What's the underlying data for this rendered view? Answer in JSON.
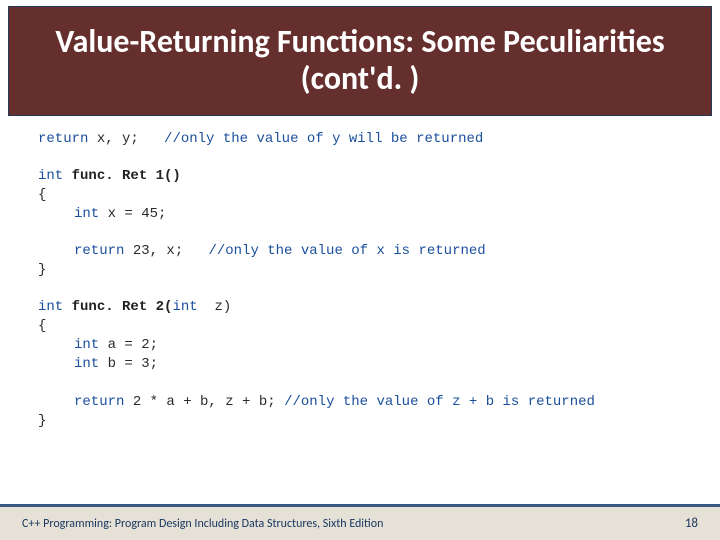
{
  "slide": {
    "title": "Value-Returning Functions: Some Peculiarities (cont'd. )"
  },
  "code": {
    "line1_return": "return",
    "line1_expr": " x, y;   ",
    "line1_comment": "//only the value of y will be returned",
    "func1_sig_kw": "int",
    "func1_sig_name": " func. Ret 1()",
    "brace_open": "{",
    "func1_decl_kw": "int",
    "func1_decl_rest": " x = 45;",
    "func1_ret_kw": "return",
    "func1_ret_expr": " 23, x;   ",
    "func1_ret_comment": "//only the value of x is returned",
    "brace_close": "}",
    "func2_sig_kw1": "int",
    "func2_sig_name": " func. Ret 2(",
    "func2_sig_kw2": "int",
    "func2_sig_rest": "  z)",
    "func2_decl1_kw": "int",
    "func2_decl1_rest": " a = 2;",
    "func2_decl2_kw": "int",
    "func2_decl2_rest": " b = 3;",
    "func2_ret_kw": "return",
    "func2_ret_expr": " 2 * a + b, z + b; ",
    "func2_ret_comment": "//only the value of z + b is returned"
  },
  "footer": {
    "source": "C++ Programming: Program Design Including Data Structures, Sixth Edition",
    "page": "18"
  }
}
